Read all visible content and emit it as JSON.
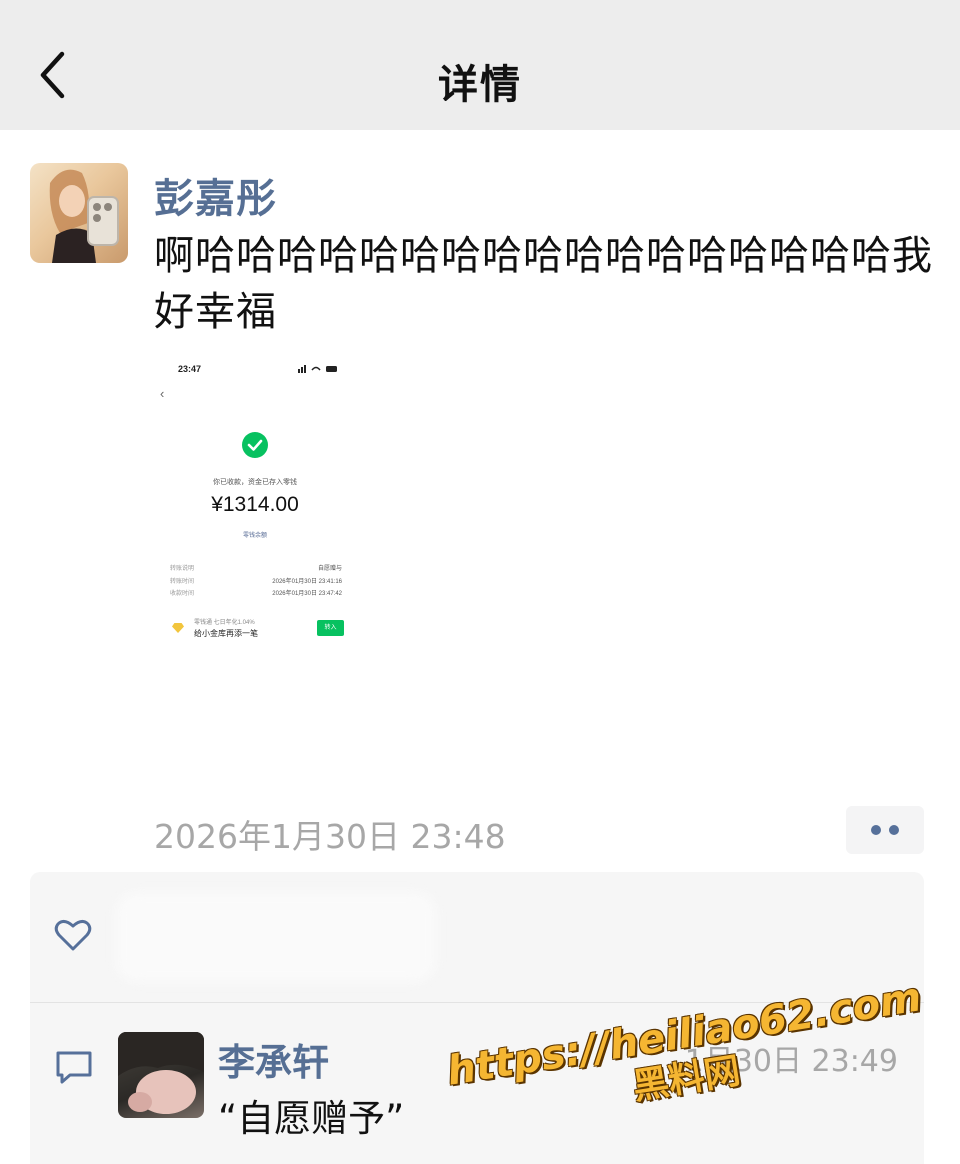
{
  "header": {
    "title": "详情"
  },
  "post": {
    "author": "彭嘉彤",
    "text": "啊哈哈哈哈哈哈哈哈哈哈哈哈哈哈哈哈哈我好幸福",
    "timestamp": "2026年1月30日 23:48",
    "attachment": {
      "status_time": "23:47",
      "received_msg": "你已收款，资金已存入零钱",
      "amount": "¥1314.00",
      "balance_link": "零钱余额",
      "rows": [
        {
          "label": "转账说明",
          "value": "自愿赠与"
        },
        {
          "label": "转账时间",
          "value": "2026年01月30日 23:41:16"
        },
        {
          "label": "收款时间",
          "value": "2026年01月30日 23:47:42"
        }
      ],
      "promo_line1": "零钱通 七日年化1.04%",
      "promo_line2": "给小金库再添一笔",
      "promo_button": "转入"
    }
  },
  "comments": [
    {
      "name": "李承轩",
      "text": "“自愿赠予”",
      "time": "1月30日 23:49"
    }
  ],
  "watermark": {
    "line1": "https://heiliao62.com",
    "line2": "黑料网"
  },
  "colors": {
    "name_blue": "#566f94",
    "header_bg": "#ededed",
    "wechat_green": "#07c160"
  },
  "icons": [
    "back-chevron-icon",
    "more-dots-icon",
    "heart-icon",
    "comment-icon"
  ]
}
